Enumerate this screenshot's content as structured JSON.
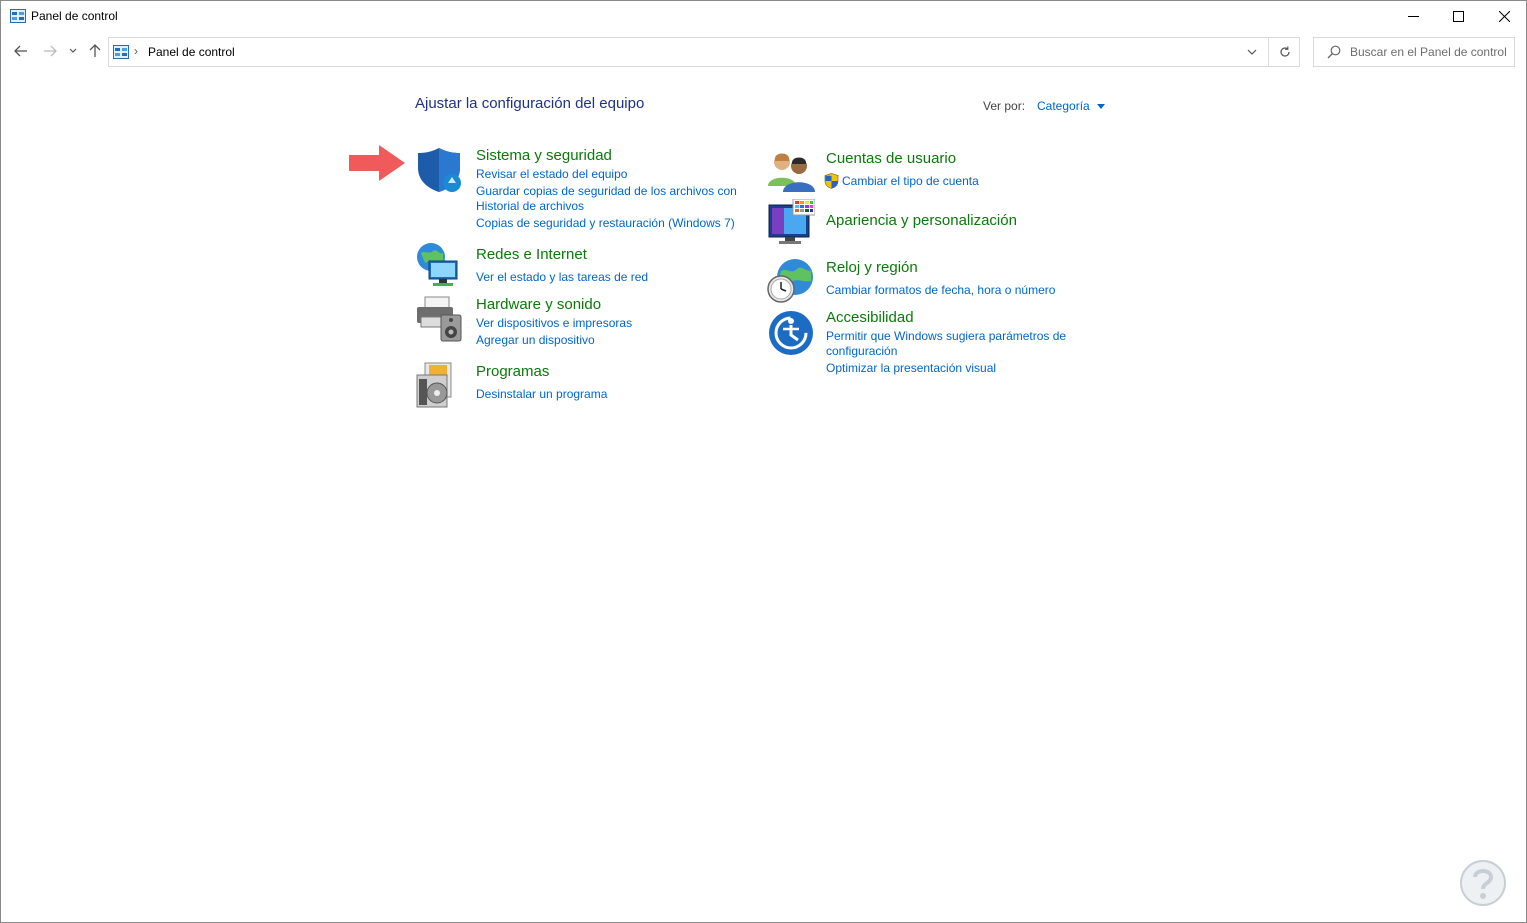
{
  "window": {
    "title": "Panel de control"
  },
  "nav": {
    "breadcrumb": "Panel de control",
    "search_placeholder": "Buscar en el Panel de control"
  },
  "main": {
    "title": "Ajustar la configuración del equipo",
    "view_by_label": "Ver por:",
    "view_by_value": "Categoría"
  },
  "categories": {
    "sistema": {
      "title": "Sistema y seguridad",
      "links": [
        "Revisar el estado del equipo",
        "Guardar copias de seguridad de los archivos con",
        "Historial de archivos",
        "Copias de seguridad y restauración (Windows 7)"
      ]
    },
    "redes": {
      "title": "Redes e Internet",
      "links": [
        "Ver el estado y las tareas de red"
      ]
    },
    "hardware": {
      "title": "Hardware y sonido",
      "links": [
        "Ver dispositivos e impresoras",
        "Agregar un dispositivo"
      ]
    },
    "programas": {
      "title": "Programas",
      "links": [
        "Desinstalar un programa"
      ]
    },
    "cuentas": {
      "title": "Cuentas de usuario",
      "links": [
        "Cambiar el tipo de cuenta"
      ]
    },
    "apariencia": {
      "title": "Apariencia y personalización",
      "links": []
    },
    "reloj": {
      "title": "Reloj y región",
      "links": [
        "Cambiar formatos de fecha, hora o número"
      ]
    },
    "accesibilidad": {
      "title": "Accesibilidad",
      "links": [
        "Permitir que Windows sugiera parámetros de",
        "configuración",
        "Optimizar la presentación visual"
      ]
    }
  },
  "colors": {
    "category_title": "#0a7a0a",
    "link": "#0066cc",
    "page_title": "#1e3287",
    "annotation_arrow": "#f05a5a"
  }
}
